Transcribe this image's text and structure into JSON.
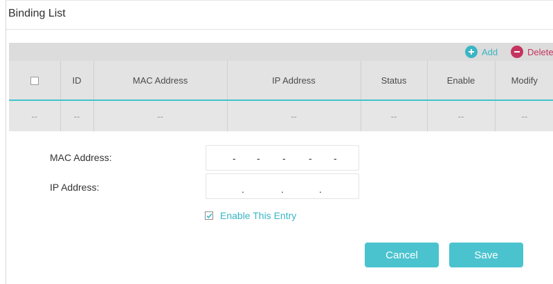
{
  "section": {
    "title": "Binding List"
  },
  "toolbar": {
    "add_label": "Add",
    "delete_label": "Delete"
  },
  "table": {
    "headers": [
      "ID",
      "MAC Address",
      "IP Address",
      "Status",
      "Enable",
      "Modify"
    ],
    "row": [
      "--",
      "--",
      "--",
      "--",
      "--",
      "--",
      "--"
    ]
  },
  "form": {
    "mac_label": "MAC Address:",
    "ip_label": "IP Address:",
    "mac_separator": "-",
    "ip_separator": ".",
    "enable_label": "Enable This Entry",
    "enable_checked": true
  },
  "buttons": {
    "cancel_label": "Cancel",
    "save_label": "Save"
  },
  "colors": {
    "accent": "#4bc3cf",
    "delete": "#c5345f",
    "header_rule": "#41c2cc"
  }
}
